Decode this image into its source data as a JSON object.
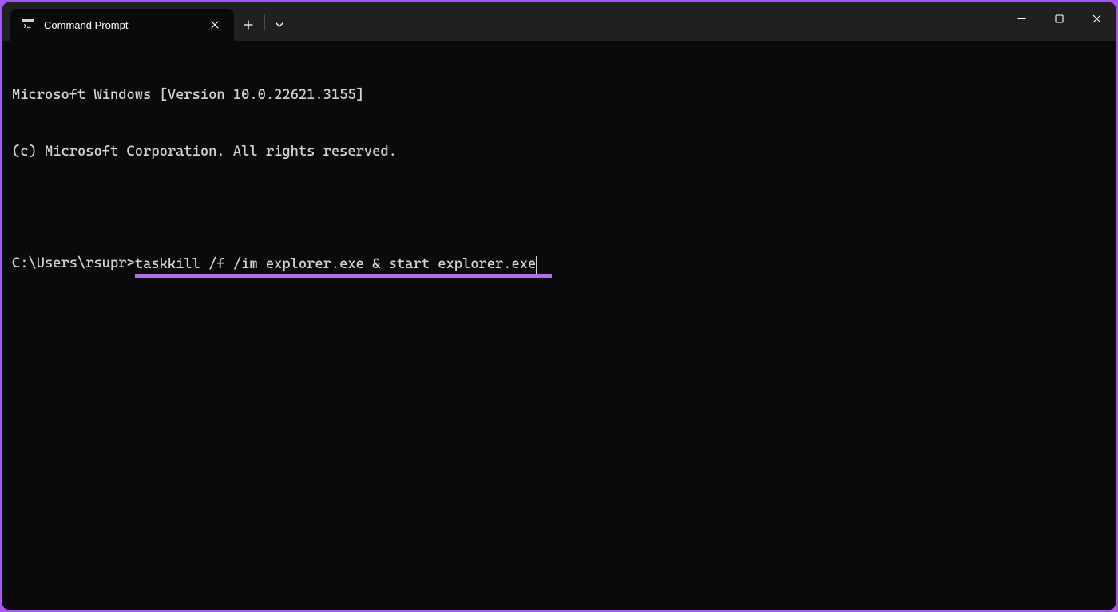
{
  "window": {
    "tab_title": "Command Prompt"
  },
  "terminal": {
    "line1": "Microsoft Windows [Version 10.0.22621.3155]",
    "line2": "(c) Microsoft Corporation. All rights reserved.",
    "prompt": "C:\\Users\\rsupr>",
    "command": "taskkill /f /im explorer.exe & start explorer.exe"
  }
}
